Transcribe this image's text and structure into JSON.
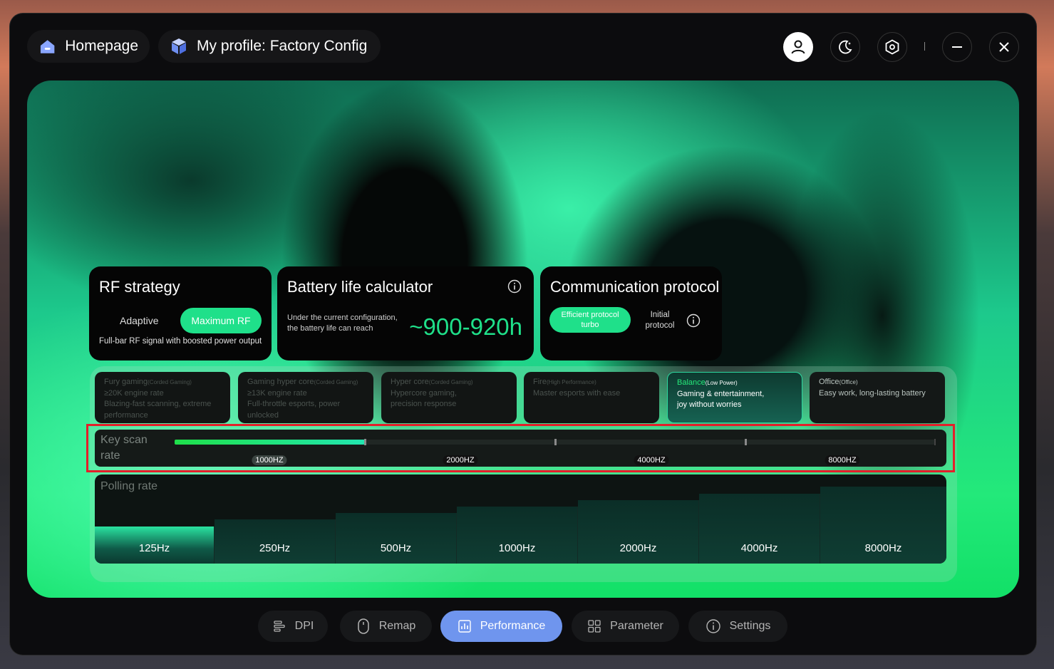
{
  "header": {
    "home_label": "Homepage",
    "profile_label": "My profile: Factory Config"
  },
  "rf_strategy": {
    "title": "RF strategy",
    "option_adaptive": "Adaptive",
    "option_maximum": "Maximum RF",
    "description": "Full-bar RF signal with boosted power output"
  },
  "battery": {
    "title": "Battery life calculator",
    "desc_line1": "Under the current configuration,",
    "desc_line2": "the battery life can reach",
    "value": "~900-920h"
  },
  "protocol": {
    "title": "Communication protocol",
    "option_efficient_line1": "Efficient protocol",
    "option_efficient_line2": "turbo",
    "option_initial_line1": "Initial",
    "option_initial_line2": "protocol"
  },
  "modes": [
    {
      "title": "Fury gaming",
      "sub": "(Corded Gaming)",
      "line1": "≥20K engine rate",
      "line2": "Blazing-fast scanning, extreme",
      "line3": "performance"
    },
    {
      "title": "Gaming hyper core",
      "sub": "(Corded Gaming)",
      "line1": "≥13K engine rate",
      "line2": "Full-throttle esports, power",
      "line3": "unlocked"
    },
    {
      "title": "Hyper core",
      "sub": "(Corded Gaming)",
      "line1": "Hypercore gaming,",
      "line2": "precision response",
      "line3": ""
    },
    {
      "title": "Fire",
      "sub": "(High Performance)",
      "line1": "Master esports with ease",
      "line2": "",
      "line3": ""
    },
    {
      "title": "Balance",
      "sub": "(Low Power)",
      "line1": "Gaming & entertainment,",
      "line2": "joy without worries",
      "line3": ""
    },
    {
      "title": "Office",
      "sub": "(Office)",
      "line1": "Easy work, long-lasting battery",
      "line2": "",
      "line3": ""
    }
  ],
  "key_scan": {
    "label_line1": "Key scan",
    "label_line2": "rate",
    "ticks": [
      "1000HZ",
      "2000HZ",
      "4000HZ",
      "8000HZ"
    ],
    "selected": "1000HZ",
    "fill_fraction": 0.25
  },
  "polling": {
    "label": "Polling rate",
    "rates": [
      "125Hz",
      "250Hz",
      "500Hz",
      "1000Hz",
      "2000Hz",
      "4000Hz",
      "8000Hz"
    ],
    "selected": "125Hz"
  },
  "nav": {
    "dpi": "DPI",
    "remap": "Remap",
    "performance": "Performance",
    "parameter": "Parameter",
    "settings": "Settings"
  },
  "colors": {
    "accent_green": "#1fe08a",
    "nav_active": "#6f95ee",
    "highlight_box": "#e41f2a"
  }
}
